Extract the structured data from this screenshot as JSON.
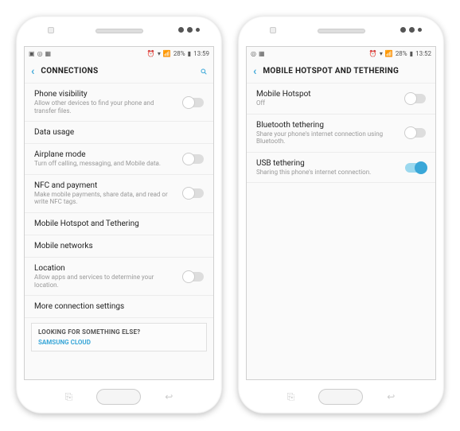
{
  "phones": {
    "left": {
      "status": {
        "time": "13:59",
        "battery": "28%"
      },
      "title": "CONNECTIONS",
      "items": [
        {
          "title": "Phone visibility",
          "sub": "Allow other devices to find your phone and transfer files.",
          "toggle": "off"
        },
        {
          "title": "Data usage",
          "sub": "",
          "toggle": ""
        },
        {
          "title": "Airplane mode",
          "sub": "Turn off calling, messaging, and Mobile data.",
          "toggle": "off"
        },
        {
          "title": "NFC and payment",
          "sub": "Make mobile payments, share data, and read or write NFC tags.",
          "toggle": "off"
        },
        {
          "title": "Mobile Hotspot and Tethering",
          "sub": "",
          "toggle": ""
        },
        {
          "title": "Mobile networks",
          "sub": "",
          "toggle": ""
        },
        {
          "title": "Location",
          "sub": "Allow apps and services to determine your location.",
          "toggle": "off"
        },
        {
          "title": "More connection settings",
          "sub": "",
          "toggle": ""
        }
      ],
      "footer": {
        "header": "LOOKING FOR SOMETHING ELSE?",
        "link": "SAMSUNG CLOUD"
      }
    },
    "right": {
      "status": {
        "time": "13:52",
        "battery": "28%"
      },
      "title": "MOBILE HOTSPOT AND TETHERING",
      "items": [
        {
          "title": "Mobile Hotspot",
          "sub": "Off",
          "toggle": "off"
        },
        {
          "title": "Bluetooth tethering",
          "sub": "Share your phone's internet connection using Bluetooth.",
          "toggle": "off"
        },
        {
          "title": "USB tethering",
          "sub": "Sharing this phone's internet connection.",
          "toggle": "on"
        }
      ]
    }
  }
}
